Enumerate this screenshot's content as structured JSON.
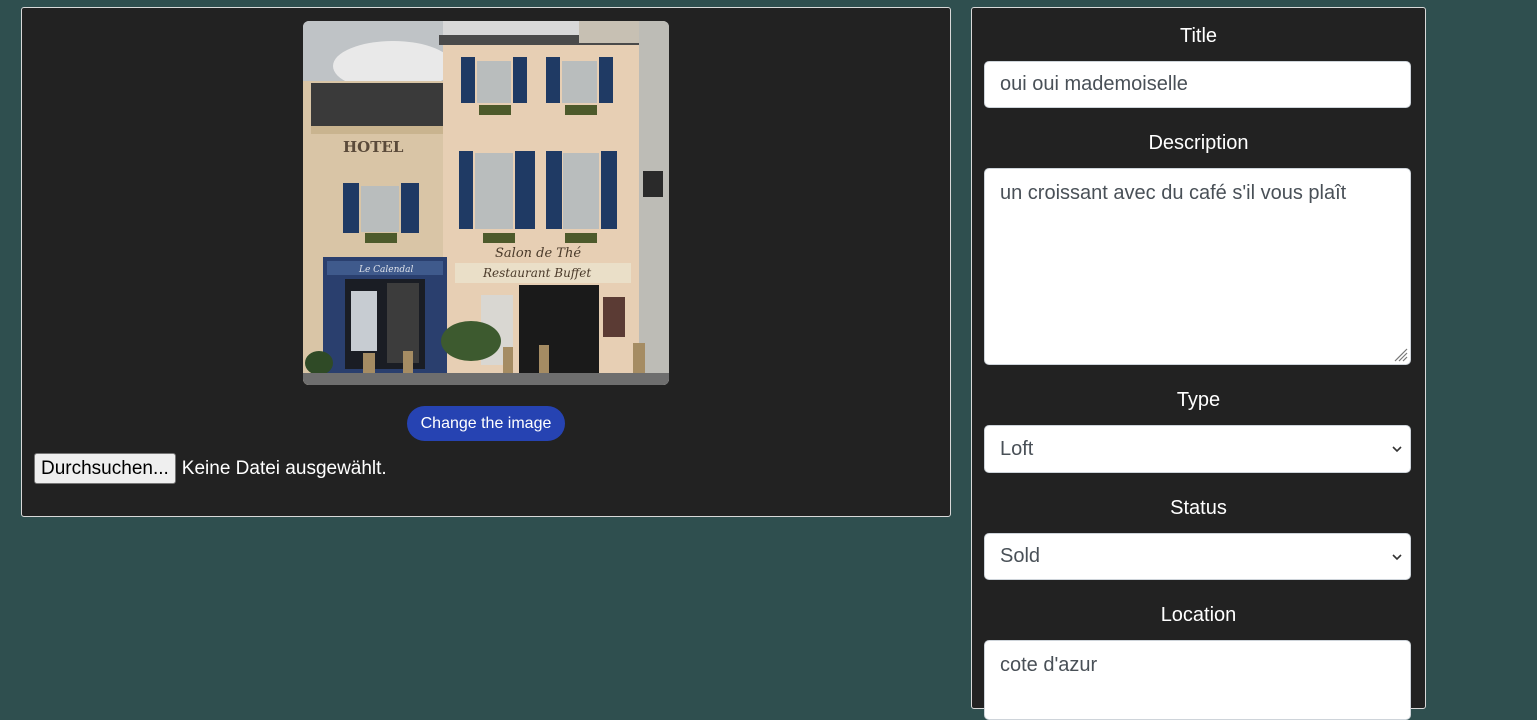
{
  "media": {
    "change_button_label": "Change the image",
    "browse_button_label": "Durchsuchen...",
    "file_status": "Keine Datei ausgewählt.",
    "photo_signs": {
      "hotel": "HOTEL",
      "salon": "Salon de Thé",
      "restaurant": "Restaurant  Buffet",
      "shop": "Le Calendal"
    }
  },
  "form": {
    "title": {
      "label": "Title",
      "value": "oui oui mademoiselle"
    },
    "description": {
      "label": "Description",
      "value": "un croissant avec du café s'il vous plaît"
    },
    "type": {
      "label": "Type",
      "value": "Loft"
    },
    "status": {
      "label": "Status",
      "value": "Sold"
    },
    "location": {
      "label": "Location",
      "value": "cote d'azur"
    }
  },
  "colors": {
    "page_background": "#2f4f4f",
    "panel_background": "#222222",
    "accent_button": "#2643b2"
  },
  "icons": {
    "select_arrow": "chevron-down-icon",
    "textarea_grip": "resize-grip-icon"
  }
}
